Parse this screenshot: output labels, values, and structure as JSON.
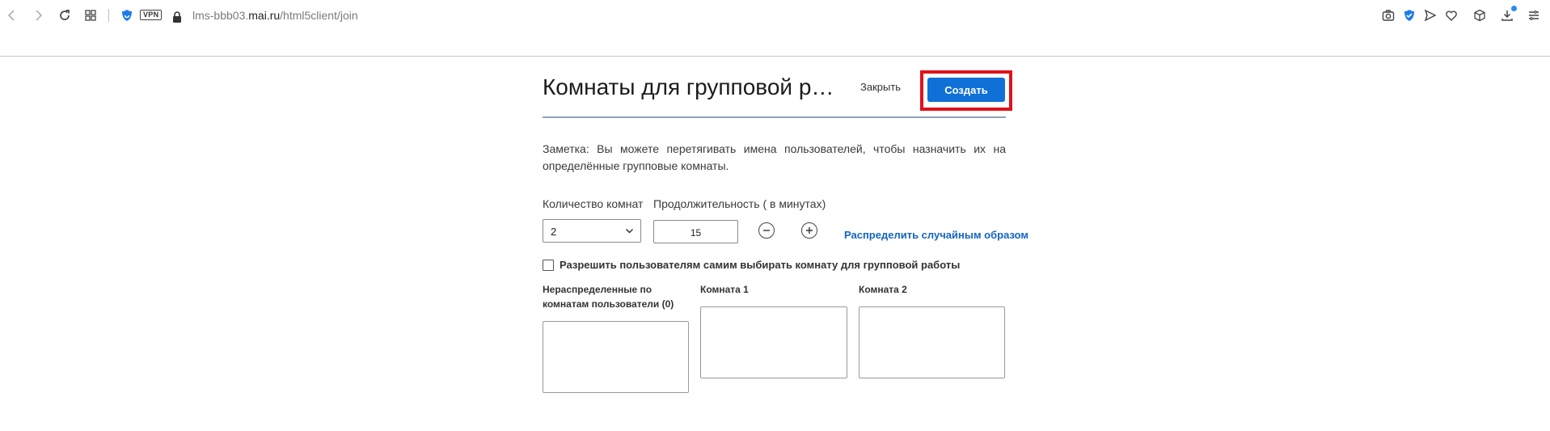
{
  "browser": {
    "url_prefix": "lms-bbb03.",
    "url_domain": "mai.ru",
    "url_path": "/html5client/join",
    "vpn_label": "VPN",
    "icons": [
      "back-icon",
      "forward-icon",
      "reload-icon",
      "grid-icon",
      "shield-icon",
      "lock-icon",
      "camera-icon",
      "verified-icon",
      "send-icon",
      "heart-icon",
      "box-icon",
      "download-icon",
      "menu-icon"
    ]
  },
  "modal": {
    "title": "Комнаты для групповой ра…",
    "close_label": "Закрыть",
    "create_label": "Создать",
    "note": "Заметка: Вы можете перетягивать имена пользователей, чтобы назначить их на определённые групповые комнаты.",
    "rooms_count_label": "Количество комнат",
    "rooms_count_value": "2",
    "duration_label": "Продолжительность ( в минутах)",
    "duration_value": "15",
    "random_link": "Распределить случайным образом",
    "allow_choose_label": "Разрешить пользователям самим выбирать комнату для групповой работы",
    "columns": [
      {
        "title_line1": "Нераспределенные по",
        "title_line2": "комнатам пользователи (0)"
      },
      {
        "title": "Комната 1"
      },
      {
        "title": "Комната 2"
      }
    ]
  },
  "colors": {
    "accent": "#0f70d7",
    "highlight": "#e0121b",
    "link": "#1565c0"
  }
}
